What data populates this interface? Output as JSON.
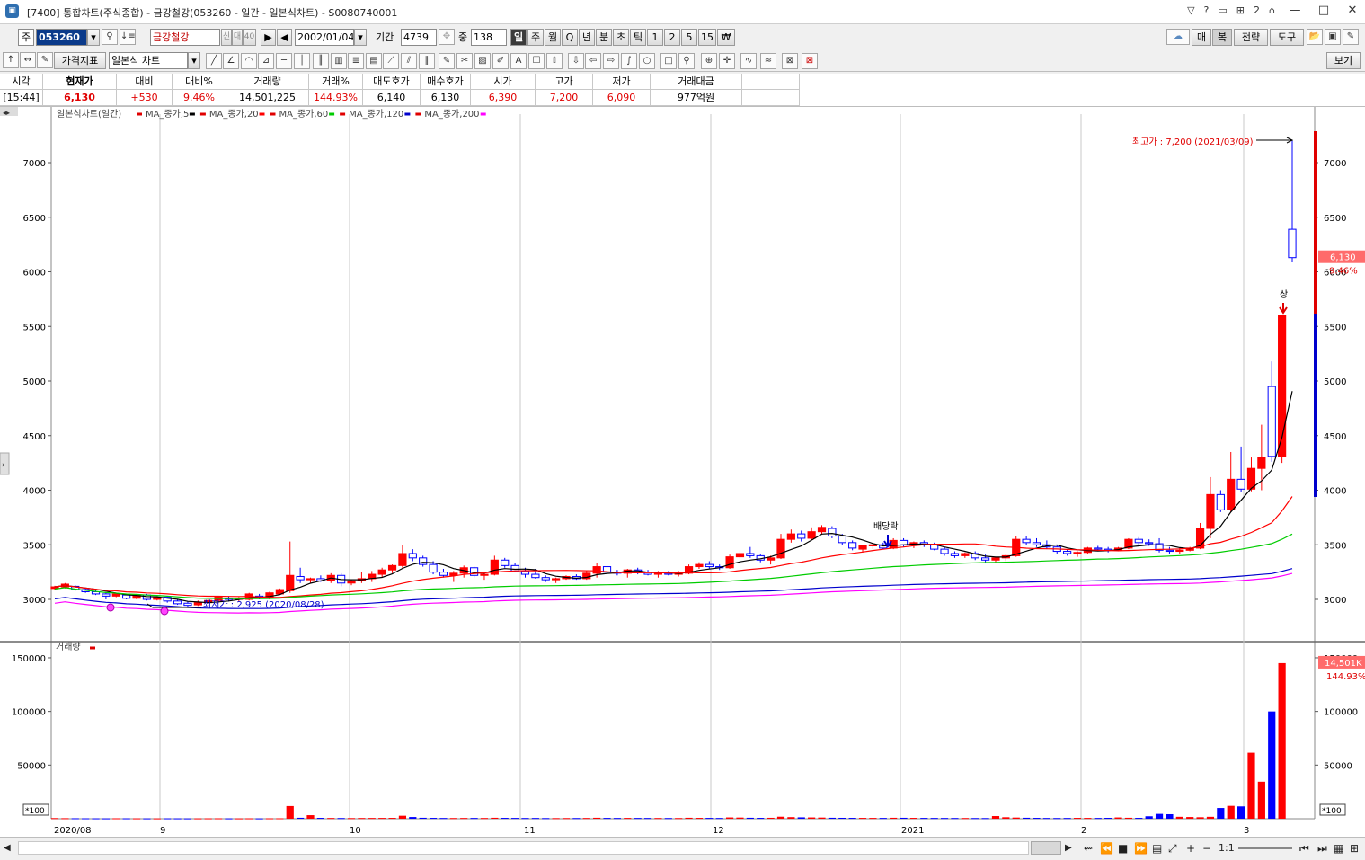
{
  "window": {
    "title": "[7400] 통합차트(주식종합) - 금강철강(053260 - 일간 - 일본식차트) - S0080740001",
    "app_icon": "chart-window-icon",
    "title_controls": [
      "?",
      "?",
      "?",
      "2",
      "?"
    ],
    "min": "—",
    "max": "□",
    "close": "✕"
  },
  "toolbar1": {
    "market": "주",
    "code": "053260",
    "name": "금강철강",
    "flags": [
      "신",
      "대",
      "40"
    ],
    "date": "2002/01/04",
    "period_label": "기간",
    "period_value": "4739",
    "count_label": "중",
    "count_value": "138",
    "intervals": [
      "일",
      "주",
      "월",
      "Q",
      "년",
      "분",
      "초",
      "틱",
      "1",
      "2",
      "5",
      "15",
      "₩"
    ],
    "right_buttons": [
      "매",
      "복",
      "전략",
      "도구"
    ]
  },
  "toolbar2": {
    "indicator_button": "가격지표",
    "chart_type": "일본식 차트",
    "view_button": "보기"
  },
  "quote": {
    "headers": [
      "시각",
      "현재가",
      "대비",
      "대비%",
      "거래량",
      "거래%",
      "매도호가",
      "매수호가",
      "시가",
      "고가",
      "저가",
      "거래대금"
    ],
    "values": [
      "[15:44]",
      "6,130",
      "+530",
      "9.46%",
      "14,501,225",
      "144.93%",
      "6,140",
      "6,130",
      "6,390",
      "7,200",
      "6,090",
      "977억원"
    ]
  },
  "chart": {
    "legend_main": "일본식차트(일간)",
    "legend_items": [
      {
        "label": "MA_종가,5",
        "color": "#000000"
      },
      {
        "label": "MA_종가,20",
        "color": "#ff0000"
      },
      {
        "label": "MA_종가,60",
        "color": "#00cc00"
      },
      {
        "label": "MA_종가,120",
        "color": "#0000cc"
      },
      {
        "label": "MA_종가,200",
        "color": "#ff00ff"
      }
    ],
    "max_label": "최고가 : 7,200 (2021/03/09)",
    "min_label": "최저가 : 2,925 (2020/08/28)",
    "dividend_label": "배당락",
    "limit_label": "상",
    "price_tag": "6,130",
    "pct_tag": "9.46%",
    "volume_legend": "거래량",
    "volume_tag": "14,501K",
    "volume_pct": "144.93%",
    "unit_label": "*100",
    "price_ticks": [
      "7000",
      "6500",
      "6000",
      "5500",
      "5000",
      "4500",
      "4000",
      "3500",
      "3000"
    ],
    "volume_ticks": [
      "150000",
      "100000",
      "50000"
    ],
    "x_labels": [
      "2020/08",
      "9",
      "10",
      "11",
      "12",
      "2021",
      "2",
      "3"
    ]
  },
  "chart_data": {
    "type": "candlestick",
    "title": "",
    "series_price_range": [
      2900,
      7300
    ],
    "volume_range": [
      0,
      155000
    ],
    "candles": [
      [
        3100,
        3125,
        3085,
        3115
      ],
      [
        3115,
        3150,
        3100,
        3140
      ],
      [
        3120,
        3130,
        3080,
        3090
      ],
      [
        3090,
        3100,
        3060,
        3070
      ],
      [
        3070,
        3085,
        3040,
        3050
      ],
      [
        3050,
        3060,
        3000,
        3030
      ],
      [
        3030,
        3060,
        3020,
        3050
      ],
      [
        3040,
        3050,
        3000,
        3010
      ],
      [
        3010,
        3045,
        3000,
        3040
      ],
      [
        3040,
        3050,
        2990,
        3000
      ],
      [
        3000,
        3030,
        2990,
        3020
      ],
      [
        3020,
        3030,
        2970,
        2985
      ],
      [
        2985,
        3000,
        2950,
        2960
      ],
      [
        2965,
        2980,
        2925,
        2945
      ],
      [
        2950,
        2990,
        2940,
        2970
      ],
      [
        2970,
        3000,
        2960,
        2990
      ],
      [
        2990,
        3030,
        2970,
        3020
      ],
      [
        3010,
        3030,
        2980,
        3000
      ],
      [
        3000,
        3020,
        2980,
        3010
      ],
      [
        3000,
        3060,
        2990,
        3050
      ],
      [
        3030,
        3050,
        3000,
        3010
      ],
      [
        3010,
        3070,
        3000,
        3060
      ],
      [
        3050,
        3100,
        3040,
        3090
      ],
      [
        3080,
        3530,
        3060,
        3220
      ],
      [
        3210,
        3290,
        3150,
        3180
      ],
      [
        3180,
        3200,
        3150,
        3190
      ],
      [
        3190,
        3220,
        3160,
        3170
      ],
      [
        3170,
        3240,
        3150,
        3220
      ],
      [
        3220,
        3240,
        3120,
        3150
      ],
      [
        3150,
        3180,
        3130,
        3170
      ],
      [
        3170,
        3250,
        3150,
        3190
      ],
      [
        3190,
        3260,
        3160,
        3230
      ],
      [
        3230,
        3290,
        3200,
        3270
      ],
      [
        3270,
        3320,
        3240,
        3310
      ],
      [
        3310,
        3500,
        3290,
        3420
      ],
      [
        3420,
        3460,
        3350,
        3380
      ],
      [
        3380,
        3400,
        3300,
        3320
      ],
      [
        3320,
        3350,
        3230,
        3250
      ],
      [
        3250,
        3280,
        3200,
        3220
      ],
      [
        3220,
        3260,
        3160,
        3240
      ],
      [
        3240,
        3310,
        3200,
        3290
      ],
      [
        3290,
        3300,
        3200,
        3220
      ],
      [
        3220,
        3250,
        3180,
        3230
      ],
      [
        3230,
        3400,
        3220,
        3360
      ],
      [
        3360,
        3380,
        3290,
        3310
      ],
      [
        3310,
        3330,
        3250,
        3260
      ],
      [
        3260,
        3290,
        3200,
        3230
      ],
      [
        3230,
        3280,
        3190,
        3200
      ],
      [
        3200,
        3220,
        3160,
        3180
      ],
      [
        3180,
        3200,
        3150,
        3190
      ],
      [
        3190,
        3220,
        3180,
        3210
      ],
      [
        3210,
        3230,
        3180,
        3190
      ],
      [
        3190,
        3260,
        3180,
        3240
      ],
      [
        3240,
        3330,
        3200,
        3300
      ],
      [
        3300,
        3310,
        3240,
        3250
      ],
      [
        3250,
        3270,
        3220,
        3240
      ],
      [
        3240,
        3280,
        3200,
        3270
      ],
      [
        3270,
        3290,
        3230,
        3250
      ],
      [
        3250,
        3270,
        3220,
        3230
      ],
      [
        3230,
        3260,
        3200,
        3240
      ],
      [
        3240,
        3260,
        3220,
        3230
      ],
      [
        3230,
        3260,
        3210,
        3240
      ],
      [
        3240,
        3320,
        3230,
        3300
      ],
      [
        3300,
        3340,
        3280,
        3320
      ],
      [
        3320,
        3350,
        3280,
        3300
      ],
      [
        3300,
        3320,
        3270,
        3290
      ],
      [
        3290,
        3410,
        3280,
        3390
      ],
      [
        3390,
        3450,
        3370,
        3420
      ],
      [
        3420,
        3480,
        3380,
        3400
      ],
      [
        3400,
        3420,
        3340,
        3360
      ],
      [
        3360,
        3400,
        3320,
        3380
      ],
      [
        3380,
        3600,
        3370,
        3550
      ],
      [
        3550,
        3640,
        3520,
        3600
      ],
      [
        3600,
        3630,
        3530,
        3560
      ],
      [
        3560,
        3660,
        3540,
        3620
      ],
      [
        3620,
        3680,
        3600,
        3660
      ],
      [
        3650,
        3670,
        3560,
        3580
      ],
      [
        3580,
        3600,
        3500,
        3520
      ],
      [
        3520,
        3540,
        3450,
        3470
      ],
      [
        3460,
        3500,
        3430,
        3490
      ],
      [
        3490,
        3520,
        3460,
        3500
      ],
      [
        3500,
        3520,
        3460,
        3470
      ],
      [
        3470,
        3560,
        3460,
        3540
      ],
      [
        3540,
        3560,
        3480,
        3500
      ],
      [
        3500,
        3530,
        3470,
        3520
      ],
      [
        3520,
        3540,
        3480,
        3500
      ],
      [
        3500,
        3520,
        3450,
        3460
      ],
      [
        3460,
        3480,
        3400,
        3420
      ],
      [
        3420,
        3440,
        3380,
        3400
      ],
      [
        3400,
        3430,
        3380,
        3420
      ],
      [
        3420,
        3440,
        3360,
        3380
      ],
      [
        3380,
        3410,
        3340,
        3360
      ],
      [
        3360,
        3390,
        3340,
        3380
      ],
      [
        3380,
        3410,
        3350,
        3400
      ],
      [
        3400,
        3580,
        3390,
        3550
      ],
      [
        3550,
        3580,
        3500,
        3520
      ],
      [
        3520,
        3560,
        3480,
        3500
      ],
      [
        3500,
        3540,
        3460,
        3480
      ],
      [
        3480,
        3500,
        3420,
        3440
      ],
      [
        3440,
        3460,
        3400,
        3420
      ],
      [
        3420,
        3440,
        3390,
        3430
      ],
      [
        3430,
        3480,
        3420,
        3470
      ],
      [
        3470,
        3490,
        3440,
        3460
      ],
      [
        3460,
        3480,
        3430,
        3450
      ],
      [
        3450,
        3480,
        3440,
        3470
      ],
      [
        3470,
        3560,
        3460,
        3550
      ],
      [
        3550,
        3570,
        3500,
        3520
      ],
      [
        3520,
        3550,
        3490,
        3510
      ],
      [
        3510,
        3560,
        3430,
        3450
      ],
      [
        3450,
        3480,
        3420,
        3440
      ],
      [
        3440,
        3470,
        3420,
        3450
      ],
      [
        3450,
        3480,
        3440,
        3470
      ],
      [
        3470,
        3700,
        3460,
        3650
      ],
      [
        3650,
        4120,
        3560,
        3960
      ],
      [
        3960,
        4000,
        3800,
        3820
      ],
      [
        3820,
        4350,
        3800,
        4100
      ],
      [
        4100,
        4400,
        3980,
        4010
      ],
      [
        4010,
        4300,
        3990,
        4200
      ],
      [
        4200,
        4600,
        4000,
        4300
      ],
      [
        4950,
        5180,
        4260,
        4310
      ],
      [
        4310,
        5600,
        4250,
        5600
      ],
      [
        6390,
        7200,
        6090,
        6130
      ]
    ],
    "volume": [
      600,
      500,
      450,
      400,
      380,
      350,
      420,
      390,
      360,
      340,
      330,
      380,
      360,
      330,
      350,
      380,
      400,
      350,
      340,
      390,
      330,
      400,
      420,
      11800,
      900,
      3300,
      800,
      700,
      650,
      600,
      680,
      720,
      750,
      800,
      2800,
      1600,
      900,
      800,
      700,
      650,
      700,
      720,
      680,
      900,
      800,
      750,
      680,
      700,
      600,
      580,
      620,
      640,
      700,
      900,
      750,
      700,
      760,
      720,
      700,
      680,
      650,
      640,
      900,
      800,
      760,
      700,
      1200,
      1100,
      900,
      800,
      880,
      1900,
      1500,
      1300,
      1200,
      1100,
      900,
      850,
      800,
      780,
      760,
      740,
      900,
      880,
      800,
      760,
      720,
      700,
      680,
      660,
      640,
      620,
      2500,
      1400,
      1100,
      900,
      800,
      700,
      650,
      700,
      800,
      760,
      720,
      820,
      1200,
      900,
      800,
      2300,
      4500,
      4200,
      1800,
      1600,
      1400,
      1800,
      10000,
      12000,
      11500,
      61500,
      34500,
      100000,
      145012
    ],
    "ma5_color": "#000000",
    "ma20_color": "#ff0000",
    "ma60_color": "#00cc00",
    "ma120_color": "#0000cc",
    "ma200_color": "#ff00ff",
    "up_color": "#ff0000",
    "down_color": "#0000ff"
  }
}
